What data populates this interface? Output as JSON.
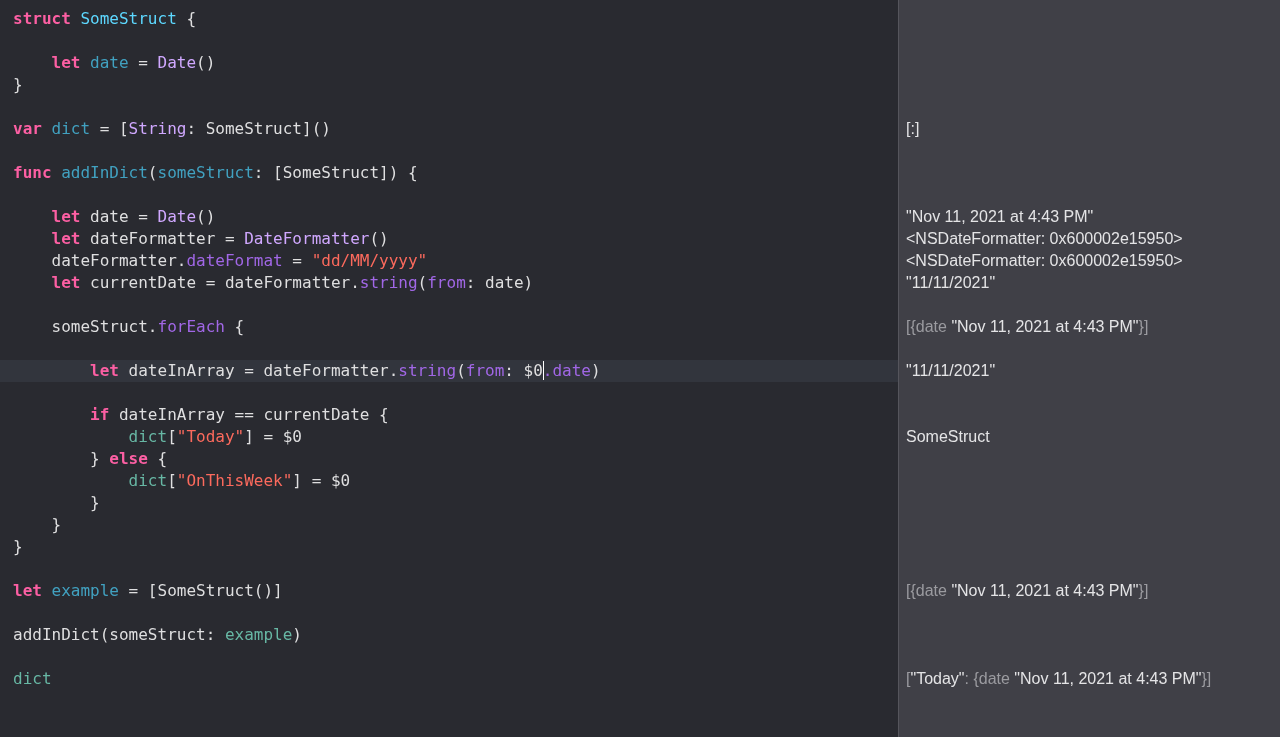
{
  "lines": [
    {
      "kind": "code",
      "tokens": [
        {
          "kind": "keyword",
          "text": "struct"
        },
        {
          "kind": "typedecl",
          "text": " SomeStruct"
        },
        {
          "kind": "plain",
          "text": " {"
        }
      ]
    },
    {
      "kind": "blank"
    },
    {
      "kind": "code",
      "tokens": [
        {
          "kind": "keyword",
          "text": "    let"
        },
        {
          "kind": "decl",
          "text": " date"
        },
        {
          "kind": "plain",
          "text": " = "
        },
        {
          "kind": "type",
          "text": "Date"
        },
        {
          "kind": "plain",
          "text": "()"
        }
      ]
    },
    {
      "kind": "code",
      "tokens": [
        {
          "kind": "plain",
          "text": "}"
        }
      ]
    },
    {
      "kind": "blank"
    },
    {
      "kind": "code",
      "tokens": [
        {
          "kind": "keyword",
          "text": "var"
        },
        {
          "kind": "decl",
          "text": " dict"
        },
        {
          "kind": "plain",
          "text": " = ["
        },
        {
          "kind": "type",
          "text": "String"
        },
        {
          "kind": "plain",
          "text": ": SomeStruct]()"
        }
      ],
      "result": [
        {
          "kind": "value",
          "text": "[:]"
        }
      ]
    },
    {
      "kind": "blank"
    },
    {
      "kind": "code",
      "tokens": [
        {
          "kind": "keyword",
          "text": "func"
        },
        {
          "kind": "decl",
          "text": " addInDict"
        },
        {
          "kind": "plain",
          "text": "("
        },
        {
          "kind": "decl",
          "text": "someStruct"
        },
        {
          "kind": "plain",
          "text": ": [SomeStruct]) {"
        }
      ]
    },
    {
      "kind": "blank"
    },
    {
      "kind": "code",
      "tokens": [
        {
          "kind": "keyword",
          "text": "    let"
        },
        {
          "kind": "plain",
          "text": " date = "
        },
        {
          "kind": "type",
          "text": "Date"
        },
        {
          "kind": "plain",
          "text": "()"
        }
      ],
      "result": [
        {
          "kind": "value",
          "text": "\"Nov 11, 2021 at 4:43 PM\""
        }
      ]
    },
    {
      "kind": "code",
      "tokens": [
        {
          "kind": "keyword",
          "text": "    let"
        },
        {
          "kind": "plain",
          "text": " dateFormatter = "
        },
        {
          "kind": "type",
          "text": "DateFormatter"
        },
        {
          "kind": "plain",
          "text": "()"
        }
      ],
      "result": [
        {
          "kind": "value",
          "text": "<NSDateFormatter: 0x600002e15950>"
        }
      ]
    },
    {
      "kind": "code",
      "tokens": [
        {
          "kind": "plain",
          "text": "    dateFormatter."
        },
        {
          "kind": "member",
          "text": "dateFormat"
        },
        {
          "kind": "plain",
          "text": " = "
        },
        {
          "kind": "string",
          "text": "\"dd/MM/yyyy\""
        }
      ],
      "result": [
        {
          "kind": "value",
          "text": "<NSDateFormatter: 0x600002e15950>"
        }
      ]
    },
    {
      "kind": "code",
      "tokens": [
        {
          "kind": "keyword",
          "text": "    let"
        },
        {
          "kind": "plain",
          "text": " currentDate = dateFormatter."
        },
        {
          "kind": "member",
          "text": "string"
        },
        {
          "kind": "plain",
          "text": "("
        },
        {
          "kind": "member",
          "text": "from"
        },
        {
          "kind": "plain",
          "text": ": date)"
        }
      ],
      "result": [
        {
          "kind": "value",
          "text": "\"11/11/2021\""
        }
      ]
    },
    {
      "kind": "blank"
    },
    {
      "kind": "code",
      "tokens": [
        {
          "kind": "plain",
          "text": "    someStruct."
        },
        {
          "kind": "member",
          "text": "forEach"
        },
        {
          "kind": "plain",
          "text": " {"
        }
      ],
      "result": [
        {
          "kind": "dim",
          "text": "[{date "
        },
        {
          "kind": "value",
          "text": "\"Nov 11, 2021 at 4:43 PM\""
        },
        {
          "kind": "dim",
          "text": "}]"
        }
      ]
    },
    {
      "kind": "blank"
    },
    {
      "kind": "code",
      "current": true,
      "tokens": [
        {
          "kind": "keyword",
          "text": "        let"
        },
        {
          "kind": "plain",
          "text": " dateInArray = dateFormatter."
        },
        {
          "kind": "member",
          "text": "string"
        },
        {
          "kind": "plain",
          "text": "("
        },
        {
          "kind": "member",
          "text": "from"
        },
        {
          "kind": "plain",
          "text": ": $0",
          "caret": true
        },
        {
          "kind": "member",
          "text": ".date"
        },
        {
          "kind": "plain",
          "text": ")"
        }
      ],
      "result": [
        {
          "kind": "value",
          "text": "\"11/11/2021\""
        }
      ]
    },
    {
      "kind": "blank"
    },
    {
      "kind": "code",
      "tokens": [
        {
          "kind": "keyword",
          "text": "        if"
        },
        {
          "kind": "plain",
          "text": " dateInArray == currentDate {"
        }
      ]
    },
    {
      "kind": "code",
      "tokens": [
        {
          "kind": "project",
          "text": "            dict"
        },
        {
          "kind": "plain",
          "text": "["
        },
        {
          "kind": "string",
          "text": "\"Today\""
        },
        {
          "kind": "plain",
          "text": "] = $0"
        }
      ],
      "result": [
        {
          "kind": "value",
          "text": "SomeStruct"
        }
      ]
    },
    {
      "kind": "code",
      "tokens": [
        {
          "kind": "plain",
          "text": "        } "
        },
        {
          "kind": "keyword",
          "text": "else"
        },
        {
          "kind": "plain",
          "text": " {"
        }
      ]
    },
    {
      "kind": "code",
      "tokens": [
        {
          "kind": "project",
          "text": "            dict"
        },
        {
          "kind": "plain",
          "text": "["
        },
        {
          "kind": "string",
          "text": "\"OnThisWeek\""
        },
        {
          "kind": "plain",
          "text": "] = $0"
        }
      ]
    },
    {
      "kind": "code",
      "tokens": [
        {
          "kind": "plain",
          "text": "        }"
        }
      ]
    },
    {
      "kind": "code",
      "tokens": [
        {
          "kind": "plain",
          "text": "    }"
        }
      ]
    },
    {
      "kind": "code",
      "tokens": [
        {
          "kind": "plain",
          "text": "}"
        }
      ]
    },
    {
      "kind": "blank"
    },
    {
      "kind": "code",
      "tokens": [
        {
          "kind": "keyword",
          "text": "let"
        },
        {
          "kind": "decl",
          "text": " example"
        },
        {
          "kind": "plain",
          "text": " = [SomeStruct()]"
        }
      ],
      "result": [
        {
          "kind": "dim",
          "text": "[{date "
        },
        {
          "kind": "value",
          "text": "\"Nov 11, 2021 at 4:43 PM\""
        },
        {
          "kind": "dim",
          "text": "}]"
        }
      ]
    },
    {
      "kind": "blank"
    },
    {
      "kind": "code",
      "tokens": [
        {
          "kind": "plain",
          "text": "addInDict(someStruct: "
        },
        {
          "kind": "project",
          "text": "example"
        },
        {
          "kind": "plain",
          "text": ")"
        }
      ]
    },
    {
      "kind": "blank"
    },
    {
      "kind": "code",
      "tokens": [
        {
          "kind": "project",
          "text": "dict"
        }
      ],
      "result": [
        {
          "kind": "dim",
          "text": "["
        },
        {
          "kind": "value",
          "text": "\"Today\""
        },
        {
          "kind": "dim",
          "text": ": {date "
        },
        {
          "kind": "value",
          "text": "\"Nov 11, 2021 at 4:43 PM\""
        },
        {
          "kind": "dim",
          "text": "}]"
        }
      ]
    }
  ]
}
